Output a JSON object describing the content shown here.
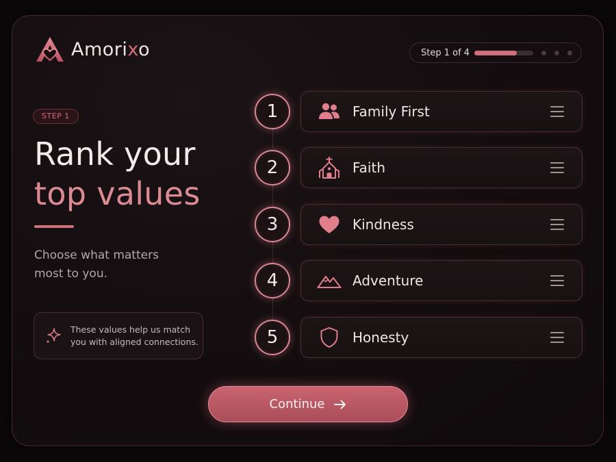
{
  "brand": {
    "name_prefix": "Amori",
    "name_accent": "x",
    "name_suffix": "o",
    "logo_icon": "heart-a-logo"
  },
  "progress": {
    "label": "Step 1 of 4",
    "fraction": 0.72,
    "total_steps": 4
  },
  "hero": {
    "step_badge": "STEP 1",
    "title_line1": "Rank your",
    "title_line2": "top values",
    "subtitle": "Choose what matters most to you."
  },
  "info": {
    "icon": "sparkle-icon",
    "text": "These values help us match you with aligned connections."
  },
  "values": [
    {
      "rank": "1",
      "label": "Family First",
      "icon": "family-icon"
    },
    {
      "rank": "2",
      "label": "Faith",
      "icon": "church-icon"
    },
    {
      "rank": "3",
      "label": "Kindness",
      "icon": "heart-icon"
    },
    {
      "rank": "4",
      "label": "Adventure",
      "icon": "mountain-icon"
    },
    {
      "rank": "5",
      "label": "Honesty",
      "icon": "shield-icon"
    }
  ],
  "actions": {
    "continue_label": "Continue",
    "continue_icon": "arrow-right-icon"
  },
  "colors": {
    "accent": "#d0707b",
    "background": "#0b0809",
    "card_border": "#4a2e34",
    "text_primary": "#f2e9ea",
    "text_muted": "#b3a7a8"
  }
}
